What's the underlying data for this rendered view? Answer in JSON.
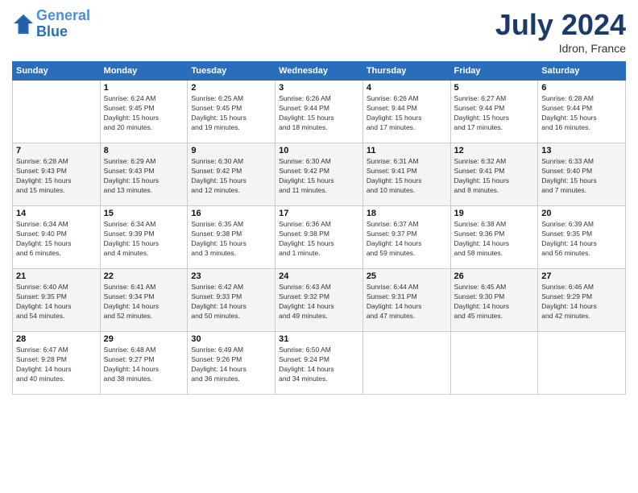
{
  "header": {
    "logo_line1": "General",
    "logo_line2": "Blue",
    "month": "July 2024",
    "location": "Idron, France"
  },
  "days_of_week": [
    "Sunday",
    "Monday",
    "Tuesday",
    "Wednesday",
    "Thursday",
    "Friday",
    "Saturday"
  ],
  "weeks": [
    [
      {
        "day": "",
        "info": ""
      },
      {
        "day": "1",
        "info": "Sunrise: 6:24 AM\nSunset: 9:45 PM\nDaylight: 15 hours\nand 20 minutes."
      },
      {
        "day": "2",
        "info": "Sunrise: 6:25 AM\nSunset: 9:45 PM\nDaylight: 15 hours\nand 19 minutes."
      },
      {
        "day": "3",
        "info": "Sunrise: 6:26 AM\nSunset: 9:44 PM\nDaylight: 15 hours\nand 18 minutes."
      },
      {
        "day": "4",
        "info": "Sunrise: 6:26 AM\nSunset: 9:44 PM\nDaylight: 15 hours\nand 17 minutes."
      },
      {
        "day": "5",
        "info": "Sunrise: 6:27 AM\nSunset: 9:44 PM\nDaylight: 15 hours\nand 17 minutes."
      },
      {
        "day": "6",
        "info": "Sunrise: 6:28 AM\nSunset: 9:44 PM\nDaylight: 15 hours\nand 16 minutes."
      }
    ],
    [
      {
        "day": "7",
        "info": "Sunrise: 6:28 AM\nSunset: 9:43 PM\nDaylight: 15 hours\nand 15 minutes."
      },
      {
        "day": "8",
        "info": "Sunrise: 6:29 AM\nSunset: 9:43 PM\nDaylight: 15 hours\nand 13 minutes."
      },
      {
        "day": "9",
        "info": "Sunrise: 6:30 AM\nSunset: 9:42 PM\nDaylight: 15 hours\nand 12 minutes."
      },
      {
        "day": "10",
        "info": "Sunrise: 6:30 AM\nSunset: 9:42 PM\nDaylight: 15 hours\nand 11 minutes."
      },
      {
        "day": "11",
        "info": "Sunrise: 6:31 AM\nSunset: 9:41 PM\nDaylight: 15 hours\nand 10 minutes."
      },
      {
        "day": "12",
        "info": "Sunrise: 6:32 AM\nSunset: 9:41 PM\nDaylight: 15 hours\nand 8 minutes."
      },
      {
        "day": "13",
        "info": "Sunrise: 6:33 AM\nSunset: 9:40 PM\nDaylight: 15 hours\nand 7 minutes."
      }
    ],
    [
      {
        "day": "14",
        "info": "Sunrise: 6:34 AM\nSunset: 9:40 PM\nDaylight: 15 hours\nand 6 minutes."
      },
      {
        "day": "15",
        "info": "Sunrise: 6:34 AM\nSunset: 9:39 PM\nDaylight: 15 hours\nand 4 minutes."
      },
      {
        "day": "16",
        "info": "Sunrise: 6:35 AM\nSunset: 9:38 PM\nDaylight: 15 hours\nand 3 minutes."
      },
      {
        "day": "17",
        "info": "Sunrise: 6:36 AM\nSunset: 9:38 PM\nDaylight: 15 hours\nand 1 minute."
      },
      {
        "day": "18",
        "info": "Sunrise: 6:37 AM\nSunset: 9:37 PM\nDaylight: 14 hours\nand 59 minutes."
      },
      {
        "day": "19",
        "info": "Sunrise: 6:38 AM\nSunset: 9:36 PM\nDaylight: 14 hours\nand 58 minutes."
      },
      {
        "day": "20",
        "info": "Sunrise: 6:39 AM\nSunset: 9:35 PM\nDaylight: 14 hours\nand 56 minutes."
      }
    ],
    [
      {
        "day": "21",
        "info": "Sunrise: 6:40 AM\nSunset: 9:35 PM\nDaylight: 14 hours\nand 54 minutes."
      },
      {
        "day": "22",
        "info": "Sunrise: 6:41 AM\nSunset: 9:34 PM\nDaylight: 14 hours\nand 52 minutes."
      },
      {
        "day": "23",
        "info": "Sunrise: 6:42 AM\nSunset: 9:33 PM\nDaylight: 14 hours\nand 50 minutes."
      },
      {
        "day": "24",
        "info": "Sunrise: 6:43 AM\nSunset: 9:32 PM\nDaylight: 14 hours\nand 49 minutes."
      },
      {
        "day": "25",
        "info": "Sunrise: 6:44 AM\nSunset: 9:31 PM\nDaylight: 14 hours\nand 47 minutes."
      },
      {
        "day": "26",
        "info": "Sunrise: 6:45 AM\nSunset: 9:30 PM\nDaylight: 14 hours\nand 45 minutes."
      },
      {
        "day": "27",
        "info": "Sunrise: 6:46 AM\nSunset: 9:29 PM\nDaylight: 14 hours\nand 42 minutes."
      }
    ],
    [
      {
        "day": "28",
        "info": "Sunrise: 6:47 AM\nSunset: 9:28 PM\nDaylight: 14 hours\nand 40 minutes."
      },
      {
        "day": "29",
        "info": "Sunrise: 6:48 AM\nSunset: 9:27 PM\nDaylight: 14 hours\nand 38 minutes."
      },
      {
        "day": "30",
        "info": "Sunrise: 6:49 AM\nSunset: 9:26 PM\nDaylight: 14 hours\nand 36 minutes."
      },
      {
        "day": "31",
        "info": "Sunrise: 6:50 AM\nSunset: 9:24 PM\nDaylight: 14 hours\nand 34 minutes."
      },
      {
        "day": "",
        "info": ""
      },
      {
        "day": "",
        "info": ""
      },
      {
        "day": "",
        "info": ""
      }
    ]
  ]
}
